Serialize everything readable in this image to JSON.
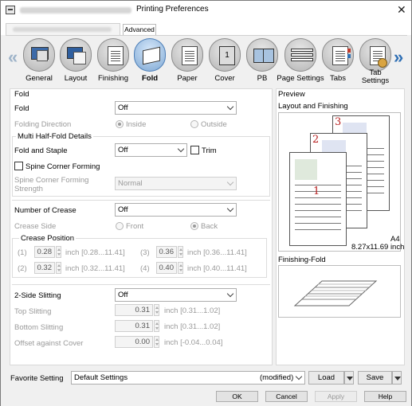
{
  "window": {
    "title": "Printing Preferences",
    "tabs": {
      "advanced": "Advanced"
    }
  },
  "categories": [
    {
      "label": "General",
      "icon": "general-icon"
    },
    {
      "label": "Layout",
      "icon": "layout-icon"
    },
    {
      "label": "Finishing",
      "icon": "finishing-icon"
    },
    {
      "label": "Fold",
      "icon": "fold-icon",
      "active": true
    },
    {
      "label": "Paper",
      "icon": "paper-icon"
    },
    {
      "label": "Cover",
      "icon": "cover-icon"
    },
    {
      "label": "PB",
      "icon": "pb-icon"
    },
    {
      "label": "Page Settings",
      "icon": "page-settings-icon"
    },
    {
      "label": "Tabs",
      "icon": "tabs-icon"
    },
    {
      "label": "Tab",
      "label2": "Settings",
      "icon": "tab-settings-icon"
    }
  ],
  "cover_icon_text": "1",
  "fold": {
    "section_title": "Fold",
    "fold_label": "Fold",
    "fold_value": "Off",
    "direction_label": "Folding Direction",
    "inside": "Inside",
    "outside": "Outside",
    "multi_group": "Multi Half-Fold Details",
    "fold_staple_label": "Fold and Staple",
    "fold_staple_value": "Off",
    "trim": "Trim",
    "spine_corner": "Spine Corner Forming",
    "spine_strength_line1": "Spine Corner Forming",
    "spine_strength_line2": "Strength",
    "spine_strength_value": "Normal"
  },
  "crease": {
    "number_label": "Number of Crease",
    "number_value": "Off",
    "side_label": "Crease Side",
    "front": "Front",
    "back": "Back",
    "position_group": "Crease Position",
    "p1_label": "(1)",
    "p1_value": "0.28",
    "p1_range": "inch [0.28...11.41]",
    "p2_label": "(2)",
    "p2_value": "0.32",
    "p2_range": "inch [0.32...11.41]",
    "p3_label": "(3)",
    "p3_value": "0.36",
    "p3_range": "inch [0.36...11.41]",
    "p4_label": "(4)",
    "p4_value": "0.40",
    "p4_range": "inch [0.40...11.41]"
  },
  "slitting": {
    "label": "2-Side Slitting",
    "value": "Off",
    "top_label": "Top Slitting",
    "top_value": "0.31",
    "top_range": "inch [0.31...1.02]",
    "bottom_label": "Bottom Slitting",
    "bottom_value": "0.31",
    "bottom_range": "inch [0.31...1.02]",
    "offset_label": "Offset against Cover",
    "offset_value": "0.00",
    "offset_range": "inch [-0.04...0.04]"
  },
  "preview": {
    "title": "Preview",
    "layout_label": "Layout and Finishing",
    "page_numbers": [
      "3",
      "2",
      "1"
    ],
    "paper_size": "A4",
    "paper_dims": "8.27x11.69 inch",
    "finishing_label": "Finishing-Fold"
  },
  "footer": {
    "favorite_label": "Favorite Setting",
    "favorite_value": "Default Settings",
    "favorite_modified": "(modified)",
    "load": "Load",
    "save": "Save",
    "ok": "OK",
    "cancel": "Cancel",
    "apply": "Apply",
    "help": "Help"
  }
}
